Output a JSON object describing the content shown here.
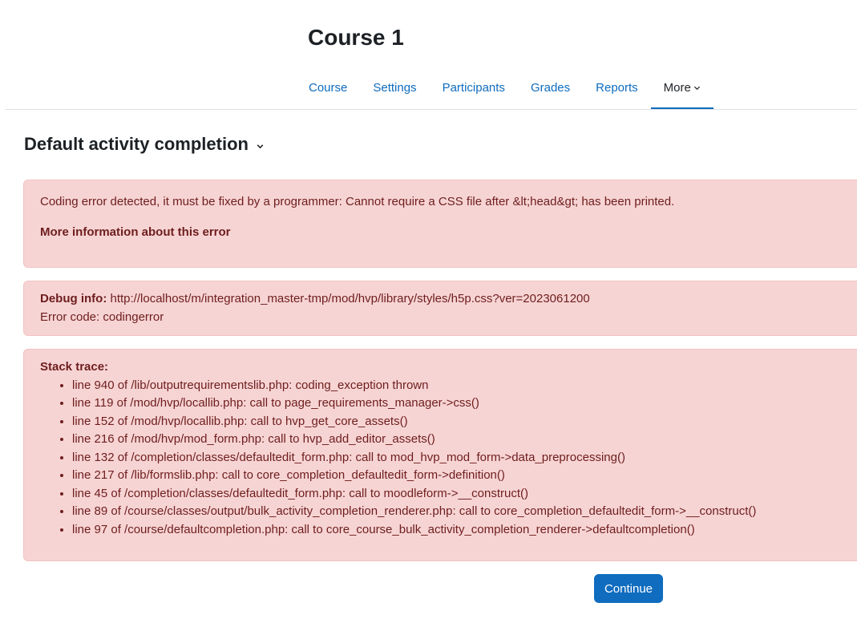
{
  "course": {
    "title": "Course 1"
  },
  "nav": {
    "tabs": [
      {
        "label": "Course"
      },
      {
        "label": "Settings"
      },
      {
        "label": "Participants"
      },
      {
        "label": "Grades"
      },
      {
        "label": "Reports"
      },
      {
        "label": "More",
        "active": true,
        "icon": "chevron-down-icon"
      }
    ]
  },
  "heading": {
    "title": "Default activity completion",
    "icon": "chevron-down-icon"
  },
  "error": {
    "message": "Coding error detected, it must be fixed by a programmer: Cannot require a CSS file after &lt;head&gt; has been printed.",
    "more_info_link": "More information about this error"
  },
  "debug": {
    "label": "Debug info:",
    "info": " http://localhost/m/integration_master-tmp/mod/hvp/library/styles/h5p.css?ver=2023061200",
    "error_code": "Error code: codingerror"
  },
  "stack": {
    "label": "Stack trace:",
    "lines": [
      "line 940 of /lib/outputrequirementslib.php: coding_exception thrown",
      "line 119 of /mod/hvp/locallib.php: call to page_requirements_manager->css()",
      "line 152 of /mod/hvp/locallib.php: call to hvp_get_core_assets()",
      "line 216 of /mod/hvp/mod_form.php: call to hvp_add_editor_assets()",
      "line 132 of /completion/classes/defaultedit_form.php: call to mod_hvp_mod_form->data_preprocessing()",
      "line 217 of /lib/formslib.php: call to core_completion_defaultedit_form->definition()",
      "line 45 of /completion/classes/defaultedit_form.php: call to moodleform->__construct()",
      "line 89 of /course/classes/output/bulk_activity_completion_renderer.php: call to core_completion_defaultedit_form->__construct()",
      "line 97 of /course/defaultcompletion.php: call to core_course_bulk_activity_completion_renderer->defaultcompletion()"
    ]
  },
  "actions": {
    "continue_label": "Continue"
  },
  "colors": {
    "accent": "#0f6cbf",
    "alert_bg": "#f7d4d4",
    "alert_text": "#6e1d1d",
    "text": "#1d2125"
  }
}
